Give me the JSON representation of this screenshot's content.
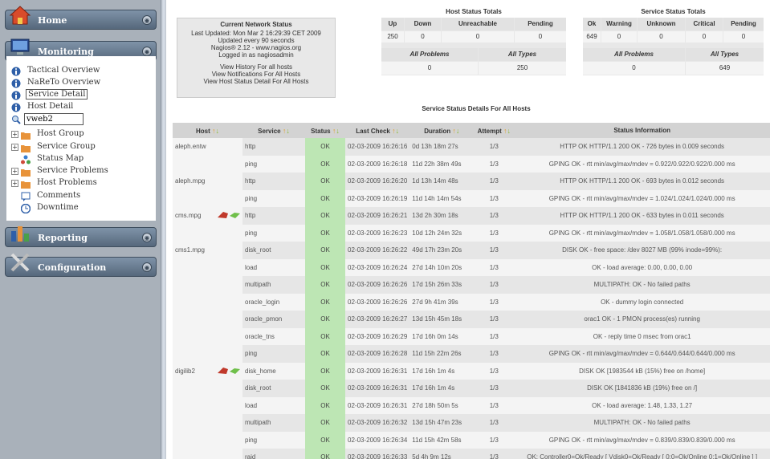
{
  "sidebar": {
    "home": "Home",
    "monitoring": "Monitoring",
    "reporting": "Reporting",
    "configuration": "Configuration",
    "items": [
      "Tactical Overview",
      "NaReTo Overview",
      "Service Detail",
      "Host Detail"
    ],
    "search_value": "vweb2",
    "items2": [
      "Host Group",
      "Service Group",
      "Status Map",
      "Service Problems",
      "Host Problems",
      "Comments",
      "Downtime"
    ]
  },
  "status": {
    "title": "Current Network Status",
    "updated": "Last Updated: Mon Mar 2 16:29:39 CET 2009",
    "every": "Updated every 90 seconds",
    "version": "Nagios® 2.12 - www.nagios.org",
    "login": "Logged in as nagiosadmin",
    "links": [
      "View History For all hosts",
      "View Notifications For All Hosts",
      "View Host Status Detail For All Hosts"
    ]
  },
  "host_totals": {
    "title": "Host Status Totals",
    "headers": [
      "Up",
      "Down",
      "Unreachable",
      "Pending"
    ],
    "values": [
      "250",
      "0",
      "0",
      "0"
    ],
    "headers2": [
      "All Problems",
      "All Types"
    ],
    "values2": [
      "0",
      "250"
    ]
  },
  "svc_totals": {
    "title": "Service Status Totals",
    "headers": [
      "Ok",
      "Warning",
      "Unknown",
      "Critical",
      "Pending"
    ],
    "values": [
      "649",
      "0",
      "0",
      "0",
      "0"
    ],
    "headers2": [
      "All Problems",
      "All Types"
    ],
    "values2": [
      "0",
      "649"
    ]
  },
  "details_title": "Service Status Details For All Hosts",
  "columns": [
    "Host",
    "Service",
    "Status",
    "Last Check",
    "Duration",
    "Attempt",
    "Status Information"
  ],
  "rows": [
    [
      "aleph.entw",
      "http",
      "OK",
      "02-03-2009 16:26:16",
      "0d 13h 18m 27s",
      "1/3",
      "HTTP OK HTTP/1.1 200 OK - 726 bytes in 0.009 seconds"
    ],
    [
      "",
      "ping",
      "OK",
      "02-03-2009 16:26:18",
      "11d 22h 38m 49s",
      "1/3",
      "GPING OK - rtt min/avg/max/mdev = 0.922/0.922/0.922/0.000 ms"
    ],
    [
      "aleph.mpg",
      "http",
      "OK",
      "02-03-2009 16:26:20",
      "1d 13h 14m 48s",
      "1/3",
      "HTTP OK HTTP/1.1 200 OK - 693 bytes in 0.012 seconds"
    ],
    [
      "",
      "ping",
      "OK",
      "02-03-2009 16:26:19",
      "11d 14h 14m 54s",
      "1/3",
      "GPING OK - rtt min/avg/max/mdev = 1.024/1.024/1.024/0.000 ms"
    ],
    [
      "cms.mpg",
      "http",
      "OK",
      "02-03-2009 16:26:21",
      "13d 2h 30m 18s",
      "1/3",
      "HTTP OK HTTP/1.1 200 OK - 633 bytes in 0.011 seconds"
    ],
    [
      "",
      "ping",
      "OK",
      "02-03-2009 16:26:23",
      "10d 12h 24m 32s",
      "1/3",
      "GPING OK - rtt min/avg/max/mdev = 1.058/1.058/1.058/0.000 ms"
    ],
    [
      "cms1.mpg",
      "disk_root",
      "OK",
      "02-03-2009 16:26:22",
      "49d 17h 23m 20s",
      "1/3",
      "DISK OK - free space: /dev 8027 MB (99% inode=99%):"
    ],
    [
      "",
      "load",
      "OK",
      "02-03-2009 16:26:24",
      "27d 14h 10m 20s",
      "1/3",
      "OK - load average: 0.00, 0.00, 0.00"
    ],
    [
      "",
      "multipath",
      "OK",
      "02-03-2009 16:26:26",
      "17d 15h 26m 33s",
      "1/3",
      "MULTIPATH: OK - No failed paths"
    ],
    [
      "",
      "oracle_login",
      "OK",
      "02-03-2009 16:26:26",
      "27d 9h 41m 39s",
      "1/3",
      "OK - dummy login connected"
    ],
    [
      "",
      "oracle_pmon",
      "OK",
      "02-03-2009 16:26:27",
      "13d 15h 45m 18s",
      "1/3",
      "orac1 OK - 1 PMON process(es) running"
    ],
    [
      "",
      "oracle_tns",
      "OK",
      "02-03-2009 16:26:29",
      "17d 16h 0m 14s",
      "1/3",
      "OK - reply time 0 msec from orac1"
    ],
    [
      "",
      "ping",
      "OK",
      "02-03-2009 16:26:28",
      "11d 15h 22m 26s",
      "1/3",
      "GPING OK - rtt min/avg/max/mdev = 0.644/0.644/0.644/0.000 ms"
    ],
    [
      "digilib2",
      "disk_home",
      "OK",
      "02-03-2009 16:26:31",
      "17d 16h 1m 4s",
      "1/3",
      "DISK OK [1983544 kB (15%) free on /home]"
    ],
    [
      "",
      "disk_root",
      "OK",
      "02-03-2009 16:26:31",
      "17d 16h 1m 4s",
      "1/3",
      "DISK OK [1841836 kB (19%) free on /]"
    ],
    [
      "",
      "load",
      "OK",
      "02-03-2009 16:26:31",
      "27d 18h 50m 5s",
      "1/3",
      "OK - load average: 1.48, 1.33, 1.27"
    ],
    [
      "",
      "multipath",
      "OK",
      "02-03-2009 16:26:32",
      "13d 15h 47m 23s",
      "1/3",
      "MULTIPATH: OK - No failed paths"
    ],
    [
      "",
      "ping",
      "OK",
      "02-03-2009 16:26:34",
      "11d 15h 42m 58s",
      "1/3",
      "GPING OK - rtt min/avg/max/mdev = 0.839/0.839/0.839/0.000 ms"
    ],
    [
      "",
      "raid",
      "OK",
      "02-03-2009 16:26:33",
      "5d 4h 9m 12s",
      "1/3",
      "OK: Controller0=Ok/Ready [ Vdisk0=Ok/Ready [ 0:0=Ok/Online 0:1=Ok/Online ] ]"
    ]
  ]
}
